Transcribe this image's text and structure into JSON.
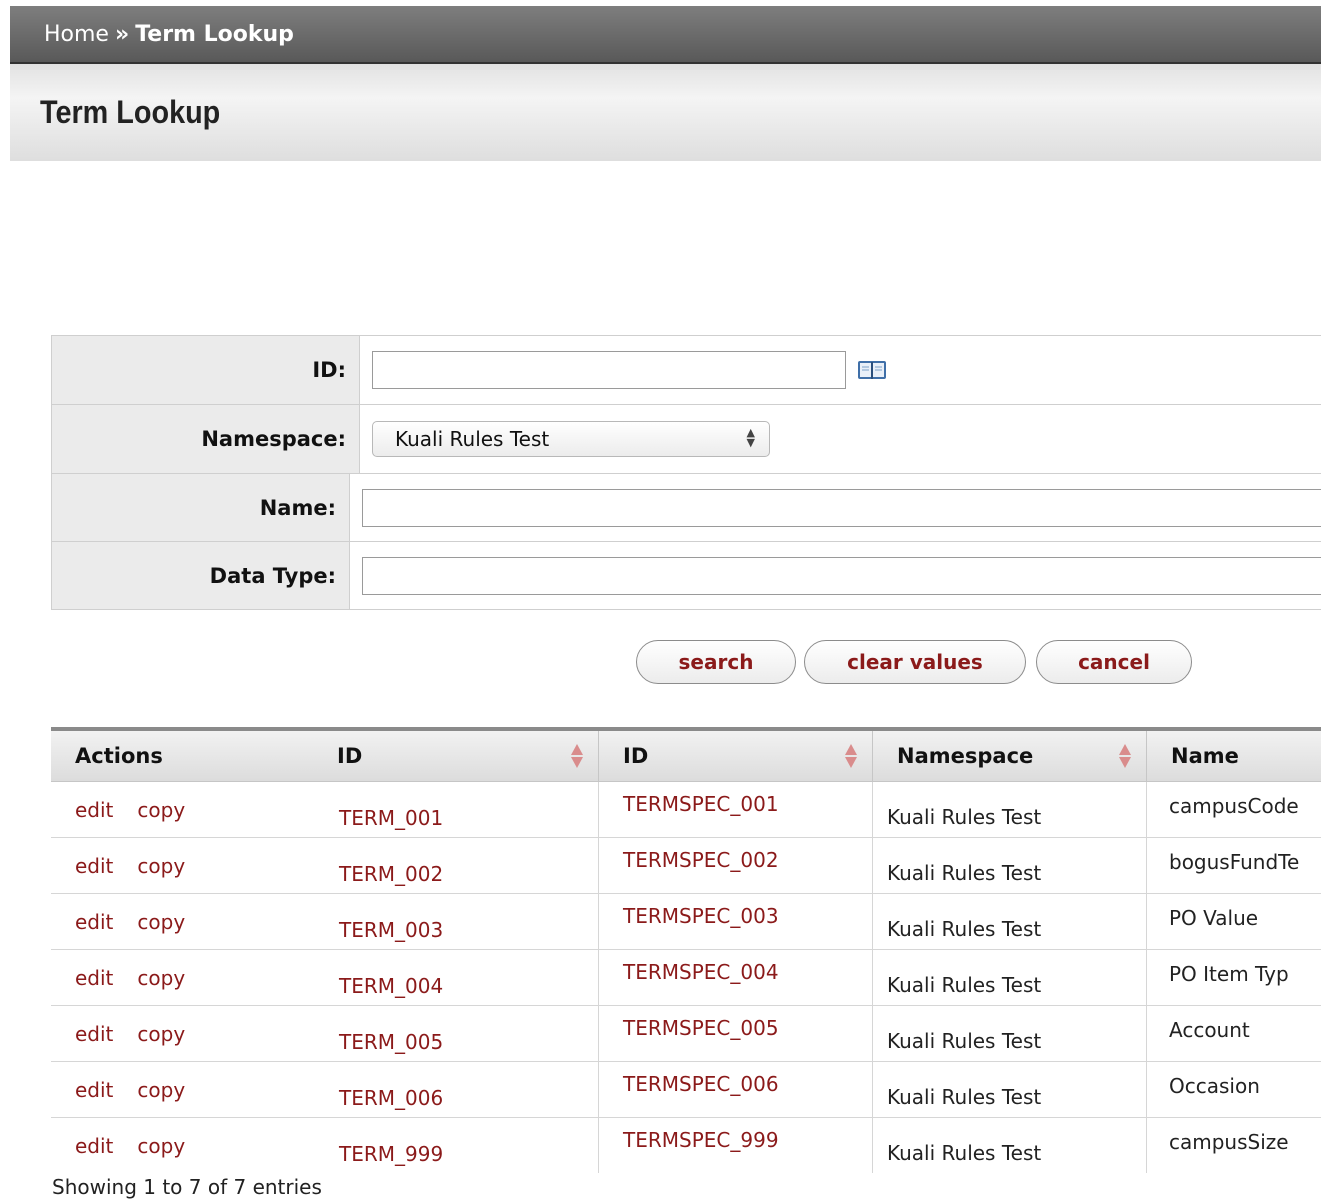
{
  "breadcrumb": {
    "home": "Home",
    "separator": "»",
    "current": "Term Lookup"
  },
  "page": {
    "title": "Term Lookup"
  },
  "criteria": {
    "id_label": "ID:",
    "id_value": "",
    "namespace_label": "Namespace:",
    "namespace_selected": "Kuali Rules Test",
    "name_label": "Name:",
    "name_value": "",
    "data_type_label": "Data Type:",
    "data_type_value": ""
  },
  "buttons": {
    "search": "search",
    "clear": "clear values",
    "cancel": "cancel"
  },
  "results": {
    "columns": [
      "Actions",
      "ID",
      "ID",
      "Namespace",
      "Name"
    ],
    "action_edit": "edit",
    "action_copy": "copy",
    "rows": [
      {
        "id": "TERM_001",
        "spec": "TERMSPEC_001",
        "namespace": "Kuali Rules Test",
        "name": "campusCode"
      },
      {
        "id": "TERM_002",
        "spec": "TERMSPEC_002",
        "namespace": "Kuali Rules Test",
        "name": "bogusFundTe"
      },
      {
        "id": "TERM_003",
        "spec": "TERMSPEC_003",
        "namespace": "Kuali Rules Test",
        "name": "PO Value"
      },
      {
        "id": "TERM_004",
        "spec": "TERMSPEC_004",
        "namespace": "Kuali Rules Test",
        "name": "PO Item Typ"
      },
      {
        "id": "TERM_005",
        "spec": "TERMSPEC_005",
        "namespace": "Kuali Rules Test",
        "name": "Account"
      },
      {
        "id": "TERM_006",
        "spec": "TERMSPEC_006",
        "namespace": "Kuali Rules Test",
        "name": "Occasion"
      },
      {
        "id": "TERM_999",
        "spec": "TERMSPEC_999",
        "namespace": "Kuali Rules Test",
        "name": "campusSize"
      }
    ],
    "summary": "Showing 1 to 7 of 7 entries"
  },
  "colors": {
    "link": "#8b1a1a",
    "topbar": "#6b6b6b",
    "label_bg": "#ebebeb",
    "sort_arrow": "#d98c8c"
  },
  "icons": {
    "lookup": "book-lookup-icon",
    "sort": "sort-arrows-icon",
    "select": "select-arrows-icon"
  }
}
